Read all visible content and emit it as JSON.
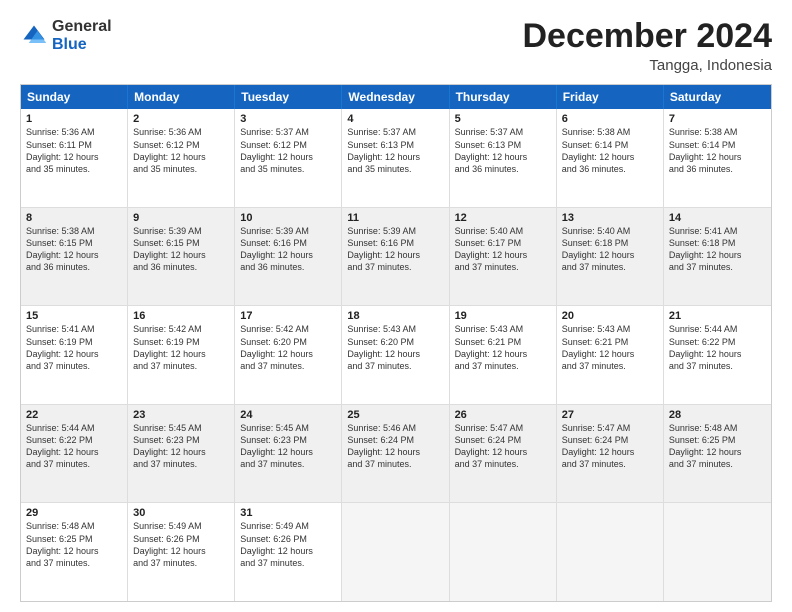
{
  "logo": {
    "general": "General",
    "blue": "Blue"
  },
  "header": {
    "title": "December 2024",
    "subtitle": "Tangga, Indonesia"
  },
  "calendar": {
    "days": [
      "Sunday",
      "Monday",
      "Tuesday",
      "Wednesday",
      "Thursday",
      "Friday",
      "Saturday"
    ],
    "rows": [
      [
        {
          "day": "1",
          "text": "Sunrise: 5:36 AM\nSunset: 6:11 PM\nDaylight: 12 hours\nand 35 minutes."
        },
        {
          "day": "2",
          "text": "Sunrise: 5:36 AM\nSunset: 6:12 PM\nDaylight: 12 hours\nand 35 minutes."
        },
        {
          "day": "3",
          "text": "Sunrise: 5:37 AM\nSunset: 6:12 PM\nDaylight: 12 hours\nand 35 minutes."
        },
        {
          "day": "4",
          "text": "Sunrise: 5:37 AM\nSunset: 6:13 PM\nDaylight: 12 hours\nand 35 minutes."
        },
        {
          "day": "5",
          "text": "Sunrise: 5:37 AM\nSunset: 6:13 PM\nDaylight: 12 hours\nand 36 minutes."
        },
        {
          "day": "6",
          "text": "Sunrise: 5:38 AM\nSunset: 6:14 PM\nDaylight: 12 hours\nand 36 minutes."
        },
        {
          "day": "7",
          "text": "Sunrise: 5:38 AM\nSunset: 6:14 PM\nDaylight: 12 hours\nand 36 minutes."
        }
      ],
      [
        {
          "day": "8",
          "text": "Sunrise: 5:38 AM\nSunset: 6:15 PM\nDaylight: 12 hours\nand 36 minutes."
        },
        {
          "day": "9",
          "text": "Sunrise: 5:39 AM\nSunset: 6:15 PM\nDaylight: 12 hours\nand 36 minutes."
        },
        {
          "day": "10",
          "text": "Sunrise: 5:39 AM\nSunset: 6:16 PM\nDaylight: 12 hours\nand 36 minutes."
        },
        {
          "day": "11",
          "text": "Sunrise: 5:39 AM\nSunset: 6:16 PM\nDaylight: 12 hours\nand 37 minutes."
        },
        {
          "day": "12",
          "text": "Sunrise: 5:40 AM\nSunset: 6:17 PM\nDaylight: 12 hours\nand 37 minutes."
        },
        {
          "day": "13",
          "text": "Sunrise: 5:40 AM\nSunset: 6:18 PM\nDaylight: 12 hours\nand 37 minutes."
        },
        {
          "day": "14",
          "text": "Sunrise: 5:41 AM\nSunset: 6:18 PM\nDaylight: 12 hours\nand 37 minutes."
        }
      ],
      [
        {
          "day": "15",
          "text": "Sunrise: 5:41 AM\nSunset: 6:19 PM\nDaylight: 12 hours\nand 37 minutes."
        },
        {
          "day": "16",
          "text": "Sunrise: 5:42 AM\nSunset: 6:19 PM\nDaylight: 12 hours\nand 37 minutes."
        },
        {
          "day": "17",
          "text": "Sunrise: 5:42 AM\nSunset: 6:20 PM\nDaylight: 12 hours\nand 37 minutes."
        },
        {
          "day": "18",
          "text": "Sunrise: 5:43 AM\nSunset: 6:20 PM\nDaylight: 12 hours\nand 37 minutes."
        },
        {
          "day": "19",
          "text": "Sunrise: 5:43 AM\nSunset: 6:21 PM\nDaylight: 12 hours\nand 37 minutes."
        },
        {
          "day": "20",
          "text": "Sunrise: 5:43 AM\nSunset: 6:21 PM\nDaylight: 12 hours\nand 37 minutes."
        },
        {
          "day": "21",
          "text": "Sunrise: 5:44 AM\nSunset: 6:22 PM\nDaylight: 12 hours\nand 37 minutes."
        }
      ],
      [
        {
          "day": "22",
          "text": "Sunrise: 5:44 AM\nSunset: 6:22 PM\nDaylight: 12 hours\nand 37 minutes."
        },
        {
          "day": "23",
          "text": "Sunrise: 5:45 AM\nSunset: 6:23 PM\nDaylight: 12 hours\nand 37 minutes."
        },
        {
          "day": "24",
          "text": "Sunrise: 5:45 AM\nSunset: 6:23 PM\nDaylight: 12 hours\nand 37 minutes."
        },
        {
          "day": "25",
          "text": "Sunrise: 5:46 AM\nSunset: 6:24 PM\nDaylight: 12 hours\nand 37 minutes."
        },
        {
          "day": "26",
          "text": "Sunrise: 5:47 AM\nSunset: 6:24 PM\nDaylight: 12 hours\nand 37 minutes."
        },
        {
          "day": "27",
          "text": "Sunrise: 5:47 AM\nSunset: 6:24 PM\nDaylight: 12 hours\nand 37 minutes."
        },
        {
          "day": "28",
          "text": "Sunrise: 5:48 AM\nSunset: 6:25 PM\nDaylight: 12 hours\nand 37 minutes."
        }
      ],
      [
        {
          "day": "29",
          "text": "Sunrise: 5:48 AM\nSunset: 6:25 PM\nDaylight: 12 hours\nand 37 minutes."
        },
        {
          "day": "30",
          "text": "Sunrise: 5:49 AM\nSunset: 6:26 PM\nDaylight: 12 hours\nand 37 minutes."
        },
        {
          "day": "31",
          "text": "Sunrise: 5:49 AM\nSunset: 6:26 PM\nDaylight: 12 hours\nand 37 minutes."
        },
        {
          "day": "",
          "text": ""
        },
        {
          "day": "",
          "text": ""
        },
        {
          "day": "",
          "text": ""
        },
        {
          "day": "",
          "text": ""
        }
      ]
    ]
  }
}
